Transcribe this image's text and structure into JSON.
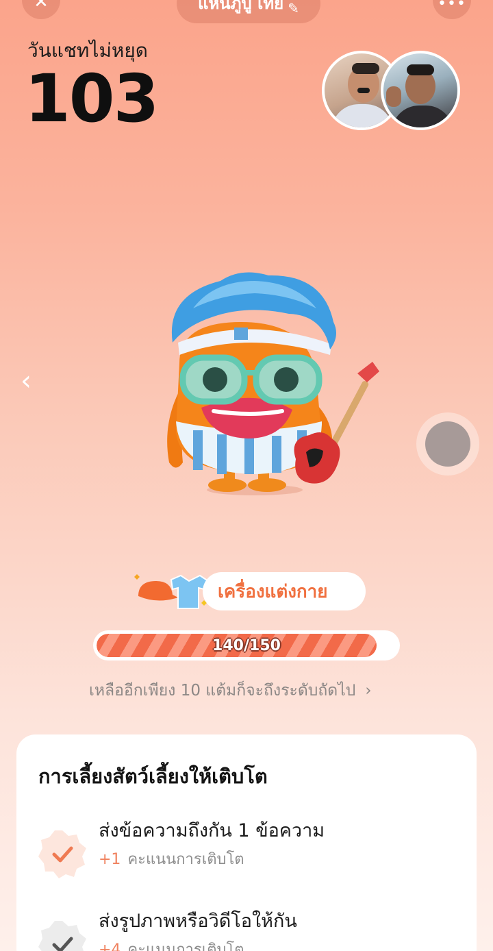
{
  "header": {
    "title": "แหนภูบู เทย",
    "title_emoji": "✏️"
  },
  "streak": {
    "label": "วันแชทไม่หยุด",
    "count": "103"
  },
  "colors": {
    "accent": "#f0703f",
    "progress_fill": "#f26a49",
    "background_top": "#fba48b",
    "background_bottom": "#fef0eb"
  },
  "icons": {
    "close": "close-icon",
    "more": "more-icon",
    "back": "chevron-left-icon",
    "next": "chevron-right-icon",
    "done": "check-icon"
  },
  "badge": {
    "label": "เครื่องแต่งกาย"
  },
  "progress": {
    "text": "140/150",
    "current": 140,
    "max": 150
  },
  "next_level": {
    "text": "เหลืออีกเพียง 10 แต้มก็จะถึงระดับถัดไป"
  },
  "tasks_card": {
    "title": "การเลี้ยงสัตว์เลี้ยงให้เติบโต",
    "tasks": [
      {
        "title": "ส่งข้อความถึงกัน 1 ข้อความ",
        "points": "+1",
        "points_label": "คะแนนการเติบโต",
        "done": true
      },
      {
        "title": "ส่งรูปภาพหรือวิดีโอให้กัน",
        "points": "+4",
        "points_label": "คะแนนการเติบโต",
        "done": true
      }
    ]
  }
}
